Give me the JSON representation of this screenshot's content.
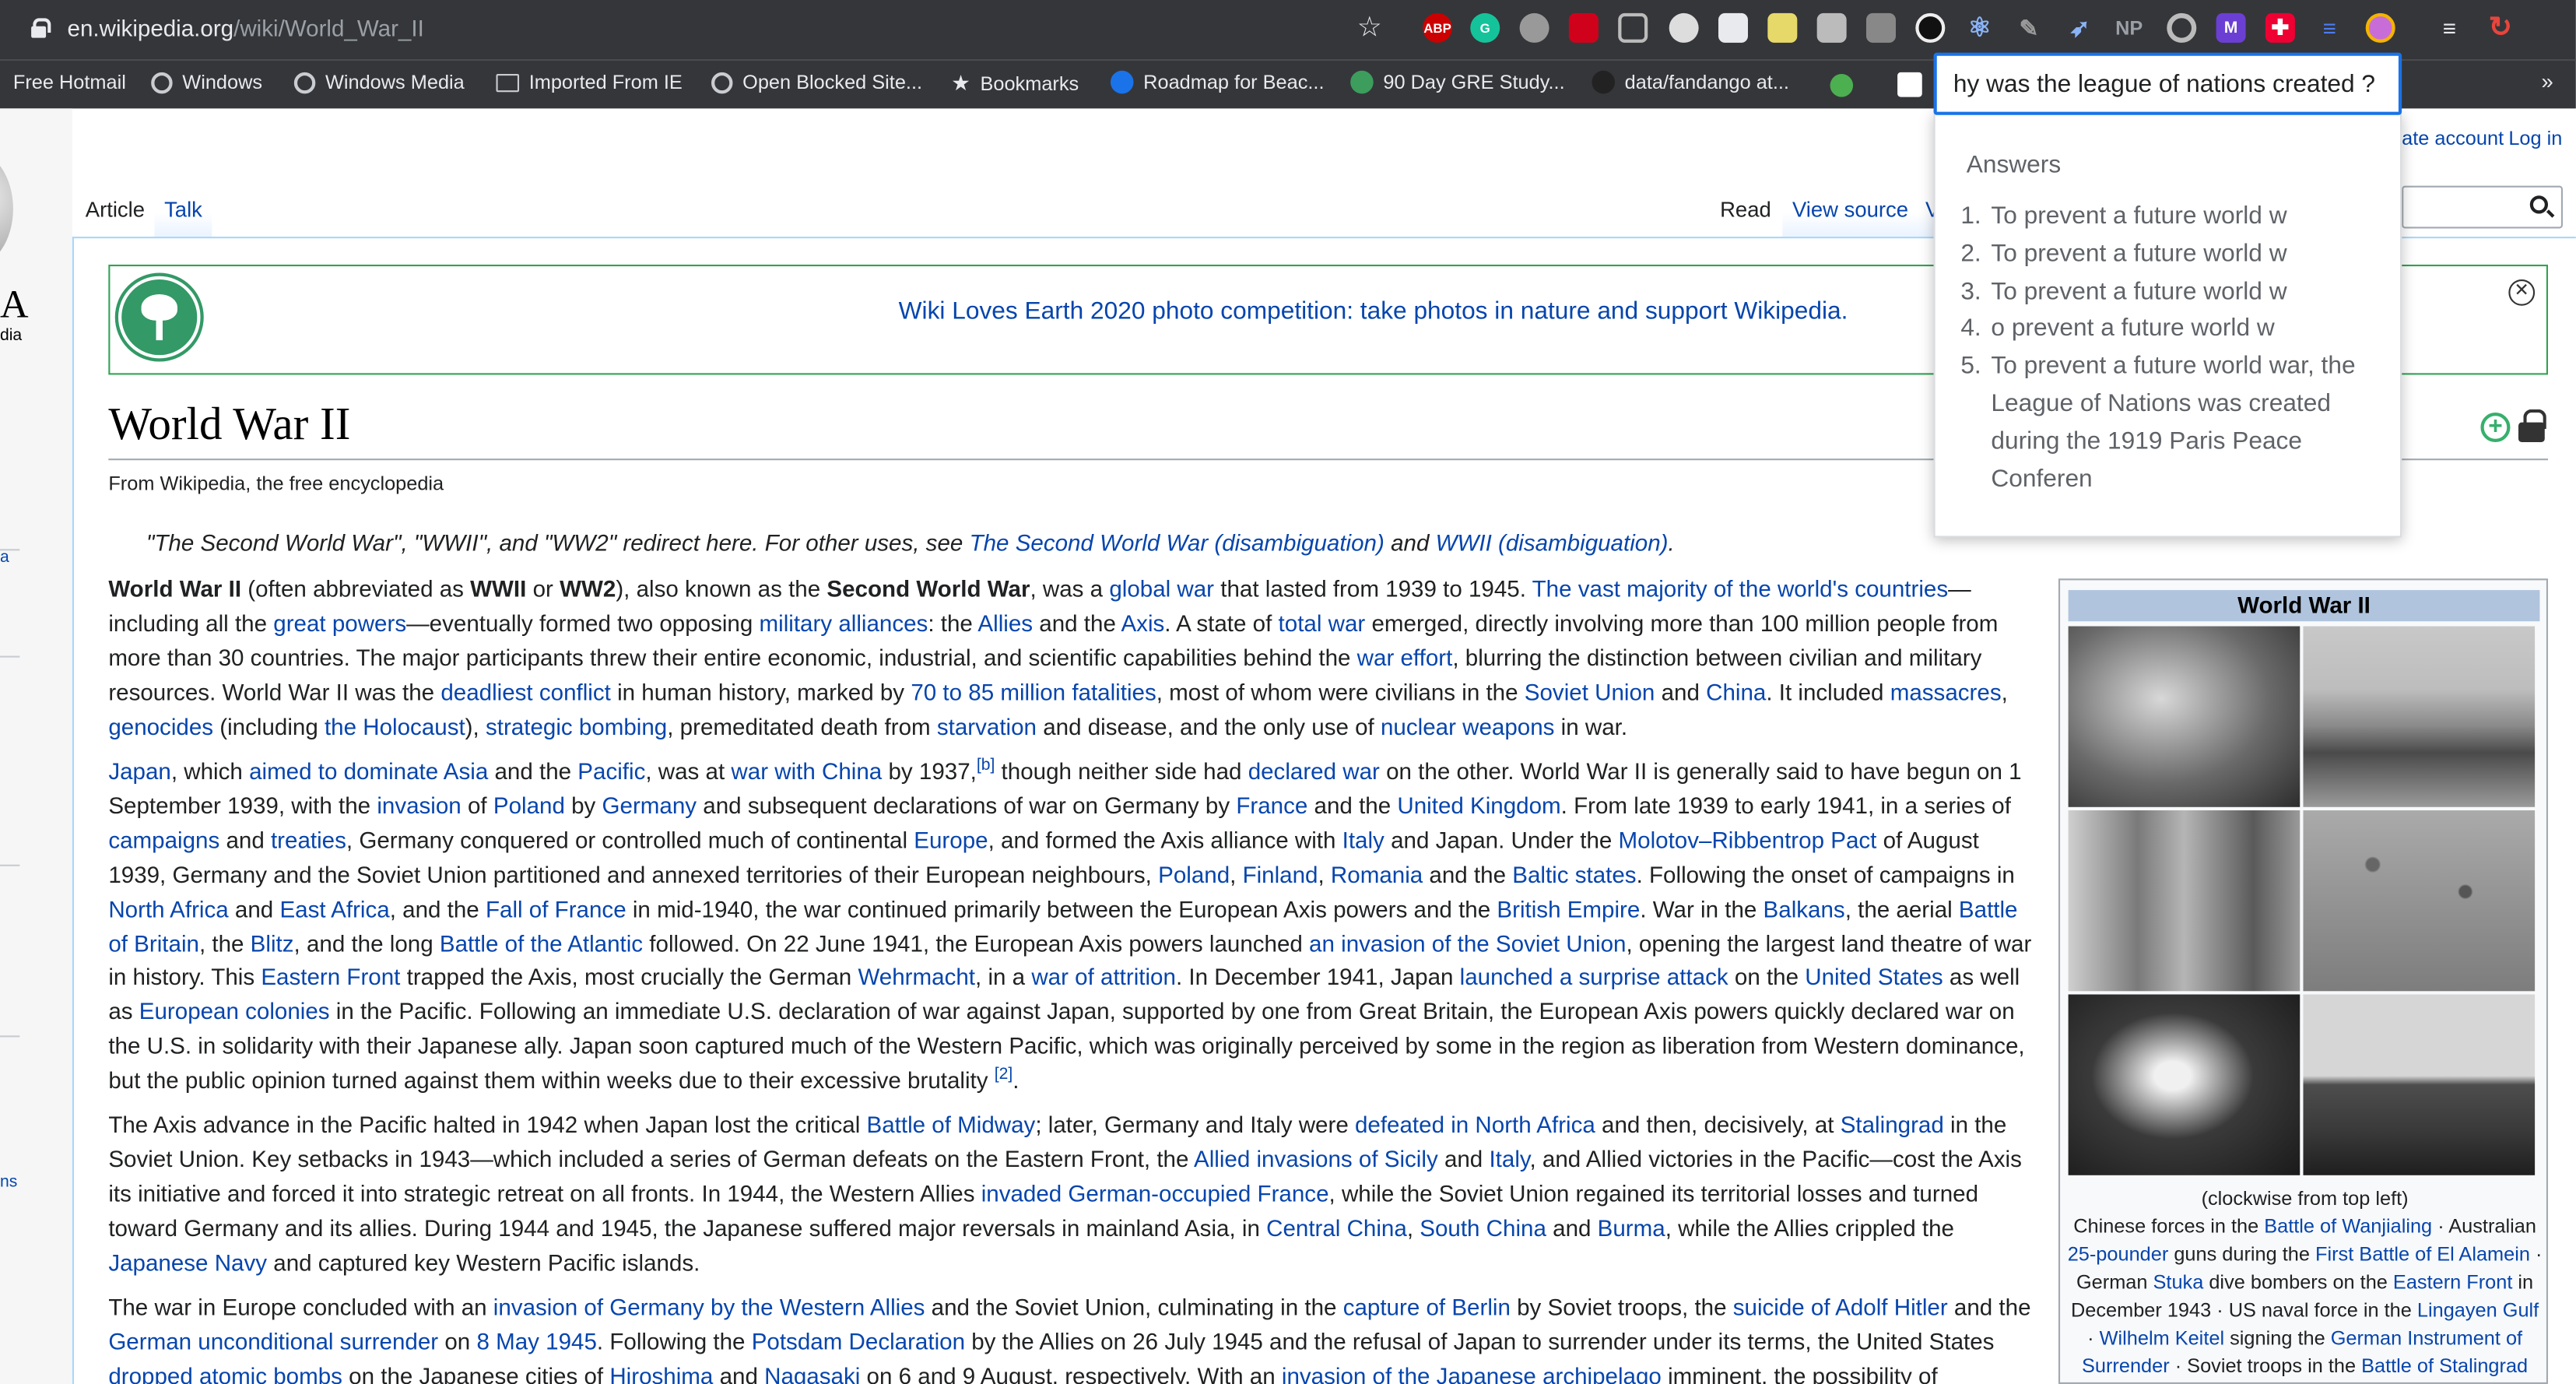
{
  "browser": {
    "url_host": "en.wikipedia.org",
    "url_path": "/wiki/World_War_II",
    "extensions": [
      "ABP",
      "G",
      "",
      "",
      "",
      "",
      "",
      "",
      "",
      "",
      "",
      "",
      "",
      "",
      "",
      "",
      "NP",
      "",
      "M",
      "",
      "",
      "",
      ""
    ]
  },
  "bookmarks": [
    {
      "label": "Free Hotmail",
      "icon": "none"
    },
    {
      "label": "Windows",
      "icon": "globe-icon"
    },
    {
      "label": "Windows Media",
      "icon": "globe-icon"
    },
    {
      "label": "Imported From IE",
      "icon": "folder-icon"
    },
    {
      "label": "Open Blocked Site...",
      "icon": "globe-icon"
    },
    {
      "label": "Bookmarks",
      "icon": "star-icon"
    },
    {
      "label": "Roadmap for Beac...",
      "icon": "app-icon"
    },
    {
      "label": "90 Day GRE Study...",
      "icon": "app-icon"
    },
    {
      "label": "data/fandango at...",
      "icon": "github-icon"
    }
  ],
  "sidebar": {
    "logo_letter": "A",
    "logo_word": "dia",
    "link_a": "a",
    "link_ns": "ns"
  },
  "tabs": {
    "article": "Article",
    "talk": "Talk",
    "read": "Read",
    "view_source": "View source",
    "view_history": "V"
  },
  "account": {
    "create": "ate account",
    "login": "Log in"
  },
  "banner": {
    "text": "Wiki Loves Earth 2020 photo competition: take photos in nature and support Wikipedia."
  },
  "page": {
    "title": "World War II",
    "subtitle": "From Wikipedia, the free encyclopedia",
    "hatnote": "\"The Second World War\", \"WWII\", and \"WW2\" redirect here. For other uses, see The Second World War (disambiguation) and WWII (disambiguation)."
  },
  "infobox": {
    "title": "World War II",
    "caption": "(clockwise from top left) Chinese forces in the Battle of Wanjialing · Australian 25-pounder guns during the First Battle of El Alamein · German Stuka dive bombers on the Eastern Front in December 1943 · US naval force in the Lingayen Gulf · Wilhelm Keitel signing the German Instrument of Surrender · Soviet troops in the Battle of Stalingrad"
  },
  "answer_popup": {
    "query": "hy was the league of nations created ?",
    "heading": "Answers",
    "answers": [
      "To prevent a future world w",
      "To prevent a future world w",
      "To prevent a future world w",
      "o prevent a future world w",
      "To prevent a future world war, the League of Nations was created during the 1919 Paris Peace Conferen"
    ]
  },
  "colors": {
    "link": "#0645ad",
    "chrome_bar": "#35363a",
    "banner_border": "#31a354",
    "infobox_header": "#b0c4de",
    "query_border": "#1a73e8"
  }
}
